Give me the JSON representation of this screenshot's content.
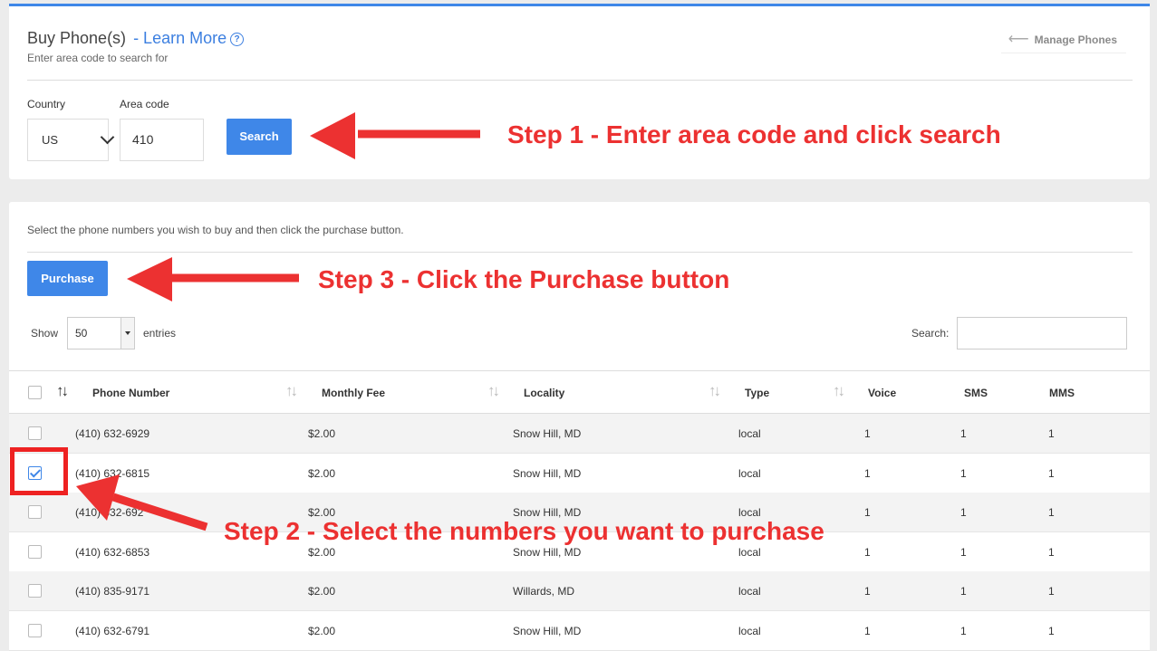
{
  "header": {
    "title": "Buy Phone(s)",
    "learn_more": "- Learn More",
    "subtitle": "Enter area code to search for",
    "manage_phones": "Manage Phones",
    "help_glyph": "?",
    "back_glyph": "⟵"
  },
  "search_form": {
    "country_label": "Country",
    "country_value": "US",
    "area_code_label": "Area code",
    "area_code_value": "410",
    "search_button": "Search"
  },
  "results": {
    "instructions": "Select the phone numbers you wish to buy and then click the purchase button.",
    "purchase_button": "Purchase",
    "show_label": "Show",
    "page_length": "50",
    "entries_label": "entries",
    "search_label": "Search:",
    "columns": {
      "phone_number": "Phone Number",
      "monthly_fee": "Monthly Fee",
      "locality": "Locality",
      "type": "Type",
      "voice": "Voice",
      "sms": "SMS",
      "mms": "MMS"
    },
    "rows": [
      {
        "phone": "(410) 632-6929",
        "fee": "$2.00",
        "locality": "Snow Hill, MD",
        "type": "local",
        "voice": "1",
        "sms": "1",
        "mms": "1",
        "checked": false
      },
      {
        "phone": "(410) 632-6815",
        "fee": "$2.00",
        "locality": "Snow Hill, MD",
        "type": "local",
        "voice": "1",
        "sms": "1",
        "mms": "1",
        "checked": true
      },
      {
        "phone": "(410) 632-692",
        "fee": "$2.00",
        "locality": "Snow Hill, MD",
        "type": "local",
        "voice": "1",
        "sms": "1",
        "mms": "1",
        "checked": false
      },
      {
        "phone": "(410) 632-6853",
        "fee": "$2.00",
        "locality": "Snow Hill, MD",
        "type": "local",
        "voice": "1",
        "sms": "1",
        "mms": "1",
        "checked": false
      },
      {
        "phone": "(410) 835-9171",
        "fee": "$2.00",
        "locality": "Willards, MD",
        "type": "local",
        "voice": "1",
        "sms": "1",
        "mms": "1",
        "checked": false
      },
      {
        "phone": "(410) 632-6791",
        "fee": "$2.00",
        "locality": "Snow Hill, MD",
        "type": "local",
        "voice": "1",
        "sms": "1",
        "mms": "1",
        "checked": false
      }
    ]
  },
  "annotations": {
    "step1": "Step 1 - Enter area code and click search",
    "step2": "Step 2 - Select the numbers you want to purchase",
    "step3": "Step 3 - Click the Purchase button",
    "color": "#ec3131"
  },
  "colors": {
    "accent": "#3f87e8",
    "link": "#3c7fe0"
  }
}
